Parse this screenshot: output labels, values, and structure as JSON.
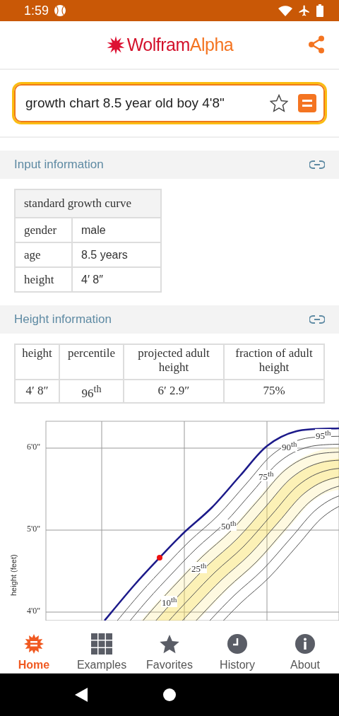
{
  "status_bar": {
    "time": "1:59"
  },
  "header": {
    "logo": {
      "brand": "Wolfram",
      "accent": "Alpha"
    }
  },
  "search": {
    "value": "growth chart 8.5 year old boy 4'8\"",
    "starred": false
  },
  "sections": [
    {
      "title": "Input information",
      "table": {
        "caption": "standard growth curve",
        "rows": [
          [
            "gender",
            "male"
          ],
          [
            "age",
            "8.5 years"
          ],
          [
            "height",
            "4′ 8″"
          ]
        ]
      }
    },
    {
      "title": "Height information",
      "table": {
        "columns": [
          "height",
          "percentile",
          "projected adult height",
          "fraction of adult height"
        ],
        "rows": [
          [
            "4′ 8″",
            "96$^{th}$",
            "6′ 2.9″",
            "75%"
          ]
        ]
      }
    }
  ],
  "chart": {
    "ylabel": "height (feet)",
    "yticks": [
      "6'0\"",
      "5'0\"",
      "4'0\""
    ],
    "curve_labels": [
      "95$^{th}$",
      "90$^{th}$",
      "75$^{th}$",
      "50$^{th}$",
      "25$^{th}$",
      "10$^{th}$"
    ]
  },
  "bottom_nav": [
    {
      "label": "Home",
      "kind": "home",
      "selected": true
    },
    {
      "label": "Examples",
      "kind": "grid",
      "selected": false
    },
    {
      "label": "Favorites",
      "kind": "star",
      "selected": false
    },
    {
      "label": "History",
      "kind": "clock",
      "selected": false
    },
    {
      "label": "About",
      "kind": "info",
      "selected": false
    }
  ]
}
